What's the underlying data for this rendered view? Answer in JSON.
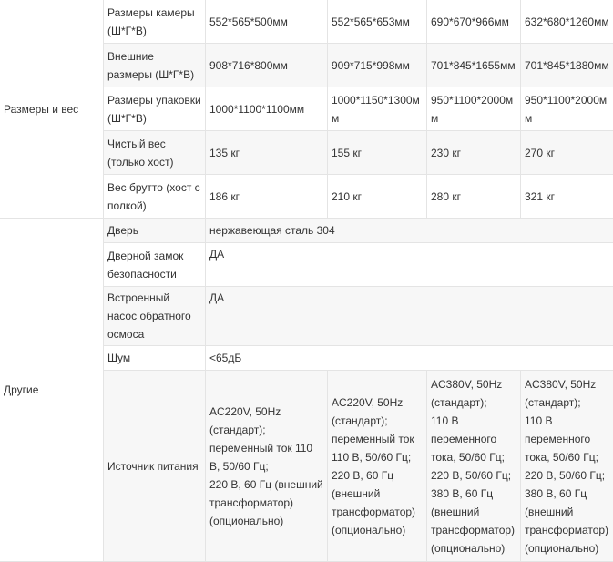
{
  "groups": {
    "size_weight": "Размеры и вес",
    "other": "Другие"
  },
  "rows": {
    "chamber": {
      "label": "Размеры камеры (Ш*Г*В)",
      "values": [
        "552*565*500мм",
        "552*565*653мм",
        "690*670*966мм",
        "632*680*1260мм"
      ]
    },
    "outer": {
      "label": "Внешние размеры (Ш*Г*В)",
      "values": [
        "908*716*800мм",
        "909*715*998мм",
        "701*845*1655мм",
        "701*845*1880мм"
      ]
    },
    "package": {
      "label": "Размеры упаковки (Ш*Г*В)",
      "values": [
        "1000*1100*1100мм",
        "1000*1150*1300мм",
        "950*1100*2000мм",
        "950*1100*2000мм"
      ]
    },
    "net": {
      "label": "Чистый вес (только хост)",
      "values": [
        "135 кг",
        "155 кг",
        "230 кг",
        "270 кг"
      ]
    },
    "gross": {
      "label": "Вес брутто (хост с полкой)",
      "values": [
        "186 кг",
        "210 кг",
        "280 кг",
        "321 кг"
      ]
    },
    "door": {
      "label": "Дверь",
      "value": "нержавеющая сталь 304"
    },
    "lock": {
      "label": "Дверной замок безопасности",
      "value": "ДА"
    },
    "pump": {
      "label": "Встроенный насос обратного осмоса",
      "value": "ДА"
    },
    "noise": {
      "label": "Шум",
      "value": "<65дБ"
    },
    "power": {
      "label": "Источник питания",
      "values": [
        "AC220V, 50Hz\n(стандарт);\nпеременный ток 110 В, 50/60 Гц;\n220 В, 60 Гц (внешний трансформатор)\n(опционально)",
        "AC220V, 50Hz\n(стандарт);\nпеременный ток 110 В, 50/60 Гц;\n220 В, 60 Гц\n(внешний трансформатор)\n(опционально)",
        "AC380V, 50Hz\n(стандарт);\n110 В\nпеременного тока, 50/60 Гц;\n220 В, 50/60 Гц;\n380 В, 60 Гц\n(внешний трансформатор)\n(опционально)",
        "AC380V, 50Hz\n(стандарт);\n110 В\nпеременного тока, 50/60 Гц;\n220 В, 50/60 Гц;\n380 В, 60 Гц\n(внешний трансформатор)\n(опционально)"
      ]
    }
  }
}
